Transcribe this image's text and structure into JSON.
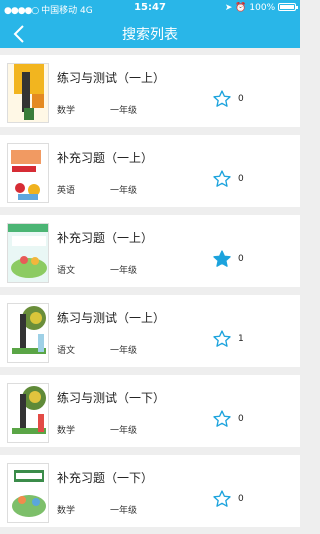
{
  "status_bar": {
    "carrier": "中国移动",
    "network": "4G",
    "time": "15:47",
    "battery": "100%",
    "battery_level": 1.0
  },
  "header": {
    "title": "搜索列表",
    "back_icon": "chevron-left-icon",
    "color": "#29b6e8"
  },
  "items": [
    {
      "title": "练习与测试（一上）",
      "subject": "数学",
      "grade": "一年级",
      "count": "0",
      "favorited": false
    },
    {
      "title": "补充习题（一上）",
      "subject": "英语",
      "grade": "一年级",
      "count": "0",
      "favorited": false
    },
    {
      "title": "补充习题（一上）",
      "subject": "语文",
      "grade": "一年级",
      "count": "0",
      "favorited": true
    },
    {
      "title": "练习与测试（一上）",
      "subject": "语文",
      "grade": "一年级",
      "count": "1",
      "favorited": false
    },
    {
      "title": "练习与测试（一下）",
      "subject": "数学",
      "grade": "一年级",
      "count": "0",
      "favorited": false
    },
    {
      "title": "补充习题（一下）",
      "subject": "数学",
      "grade": "一年级",
      "count": "0",
      "favorited": false
    }
  ],
  "colors": {
    "accent": "#29b6e8",
    "star_filled": "#1ca3dd"
  }
}
